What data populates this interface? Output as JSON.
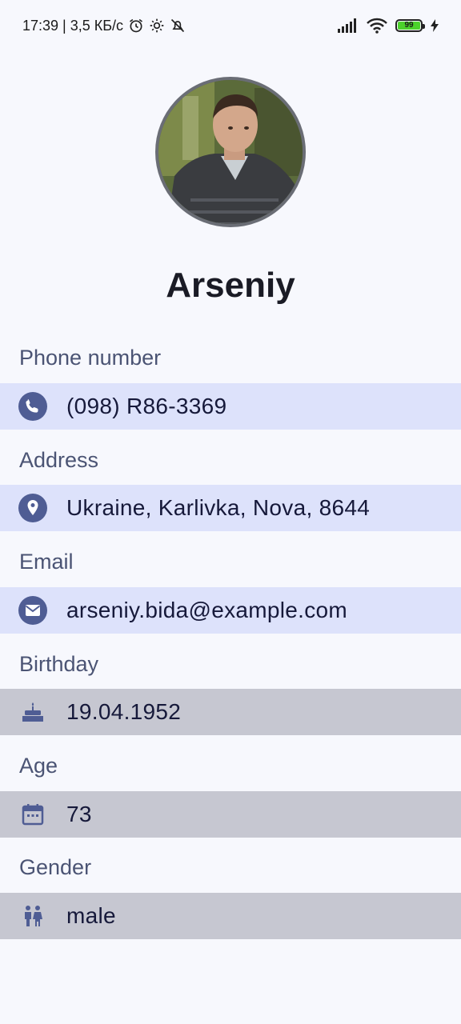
{
  "status_bar": {
    "time_speed": "17:39 | 3,5 КБ/с",
    "battery": "99"
  },
  "profile": {
    "name": "Arseniy"
  },
  "fields": {
    "phone": {
      "label": "Phone number",
      "value": "(098) R86-3369",
      "icon": "phone-icon"
    },
    "address": {
      "label": "Address",
      "value": "Ukraine, Karlivka, Nova, 8644",
      "icon": "location-pin-icon"
    },
    "email": {
      "label": "Email",
      "value": "arseniy.bida@example.com",
      "icon": "mail-icon"
    },
    "birthday": {
      "label": "Birthday",
      "value": "19.04.1952",
      "icon": "cake-icon"
    },
    "age": {
      "label": "Age",
      "value": "73",
      "icon": "calendar-icon"
    },
    "gender": {
      "label": "Gender",
      "value": "male",
      "icon": "people-icon"
    }
  },
  "colors": {
    "accent": "#4f5d94",
    "row_highlight": "#dde2fb",
    "row_disabled": "#c6c7d1",
    "background": "#f7f8fd"
  }
}
